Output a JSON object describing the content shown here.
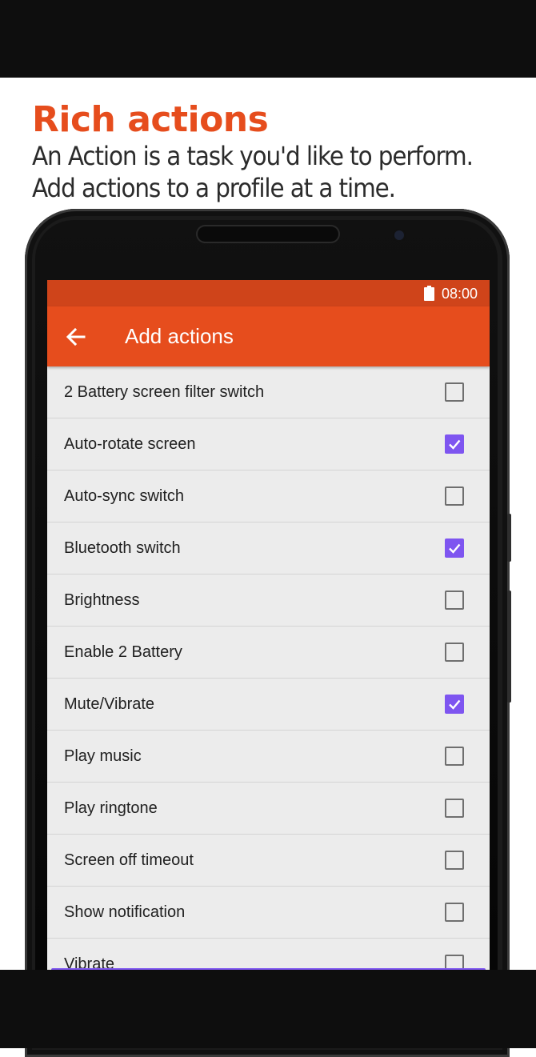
{
  "promo": {
    "headline": "Rich actions",
    "subline_1": "An Action is a task you'd like to perform.",
    "subline_2": "Add actions to a profile at a time."
  },
  "status_bar": {
    "time": "08:00",
    "battery_icon": "battery-full-icon"
  },
  "app_bar": {
    "back_icon": "arrow-back-icon",
    "title": "Add actions"
  },
  "actions": [
    {
      "label": "2 Battery screen filter switch",
      "checked": false
    },
    {
      "label": "Auto-rotate screen",
      "checked": true
    },
    {
      "label": "Auto-sync switch",
      "checked": false
    },
    {
      "label": "Bluetooth switch",
      "checked": true
    },
    {
      "label": "Brightness",
      "checked": false
    },
    {
      "label": "Enable 2 Battery",
      "checked": false
    },
    {
      "label": "Mute/Vibrate",
      "checked": true
    },
    {
      "label": "Play music",
      "checked": false
    },
    {
      "label": "Play ringtone",
      "checked": false
    },
    {
      "label": "Screen off timeout",
      "checked": false
    },
    {
      "label": "Show notification",
      "checked": false
    },
    {
      "label": "Vibrate",
      "checked": false
    }
  ],
  "colors": {
    "accent_orange": "#e64d1d",
    "status_bar": "#cf441a",
    "checkbox_checked": "#7e55f0"
  }
}
